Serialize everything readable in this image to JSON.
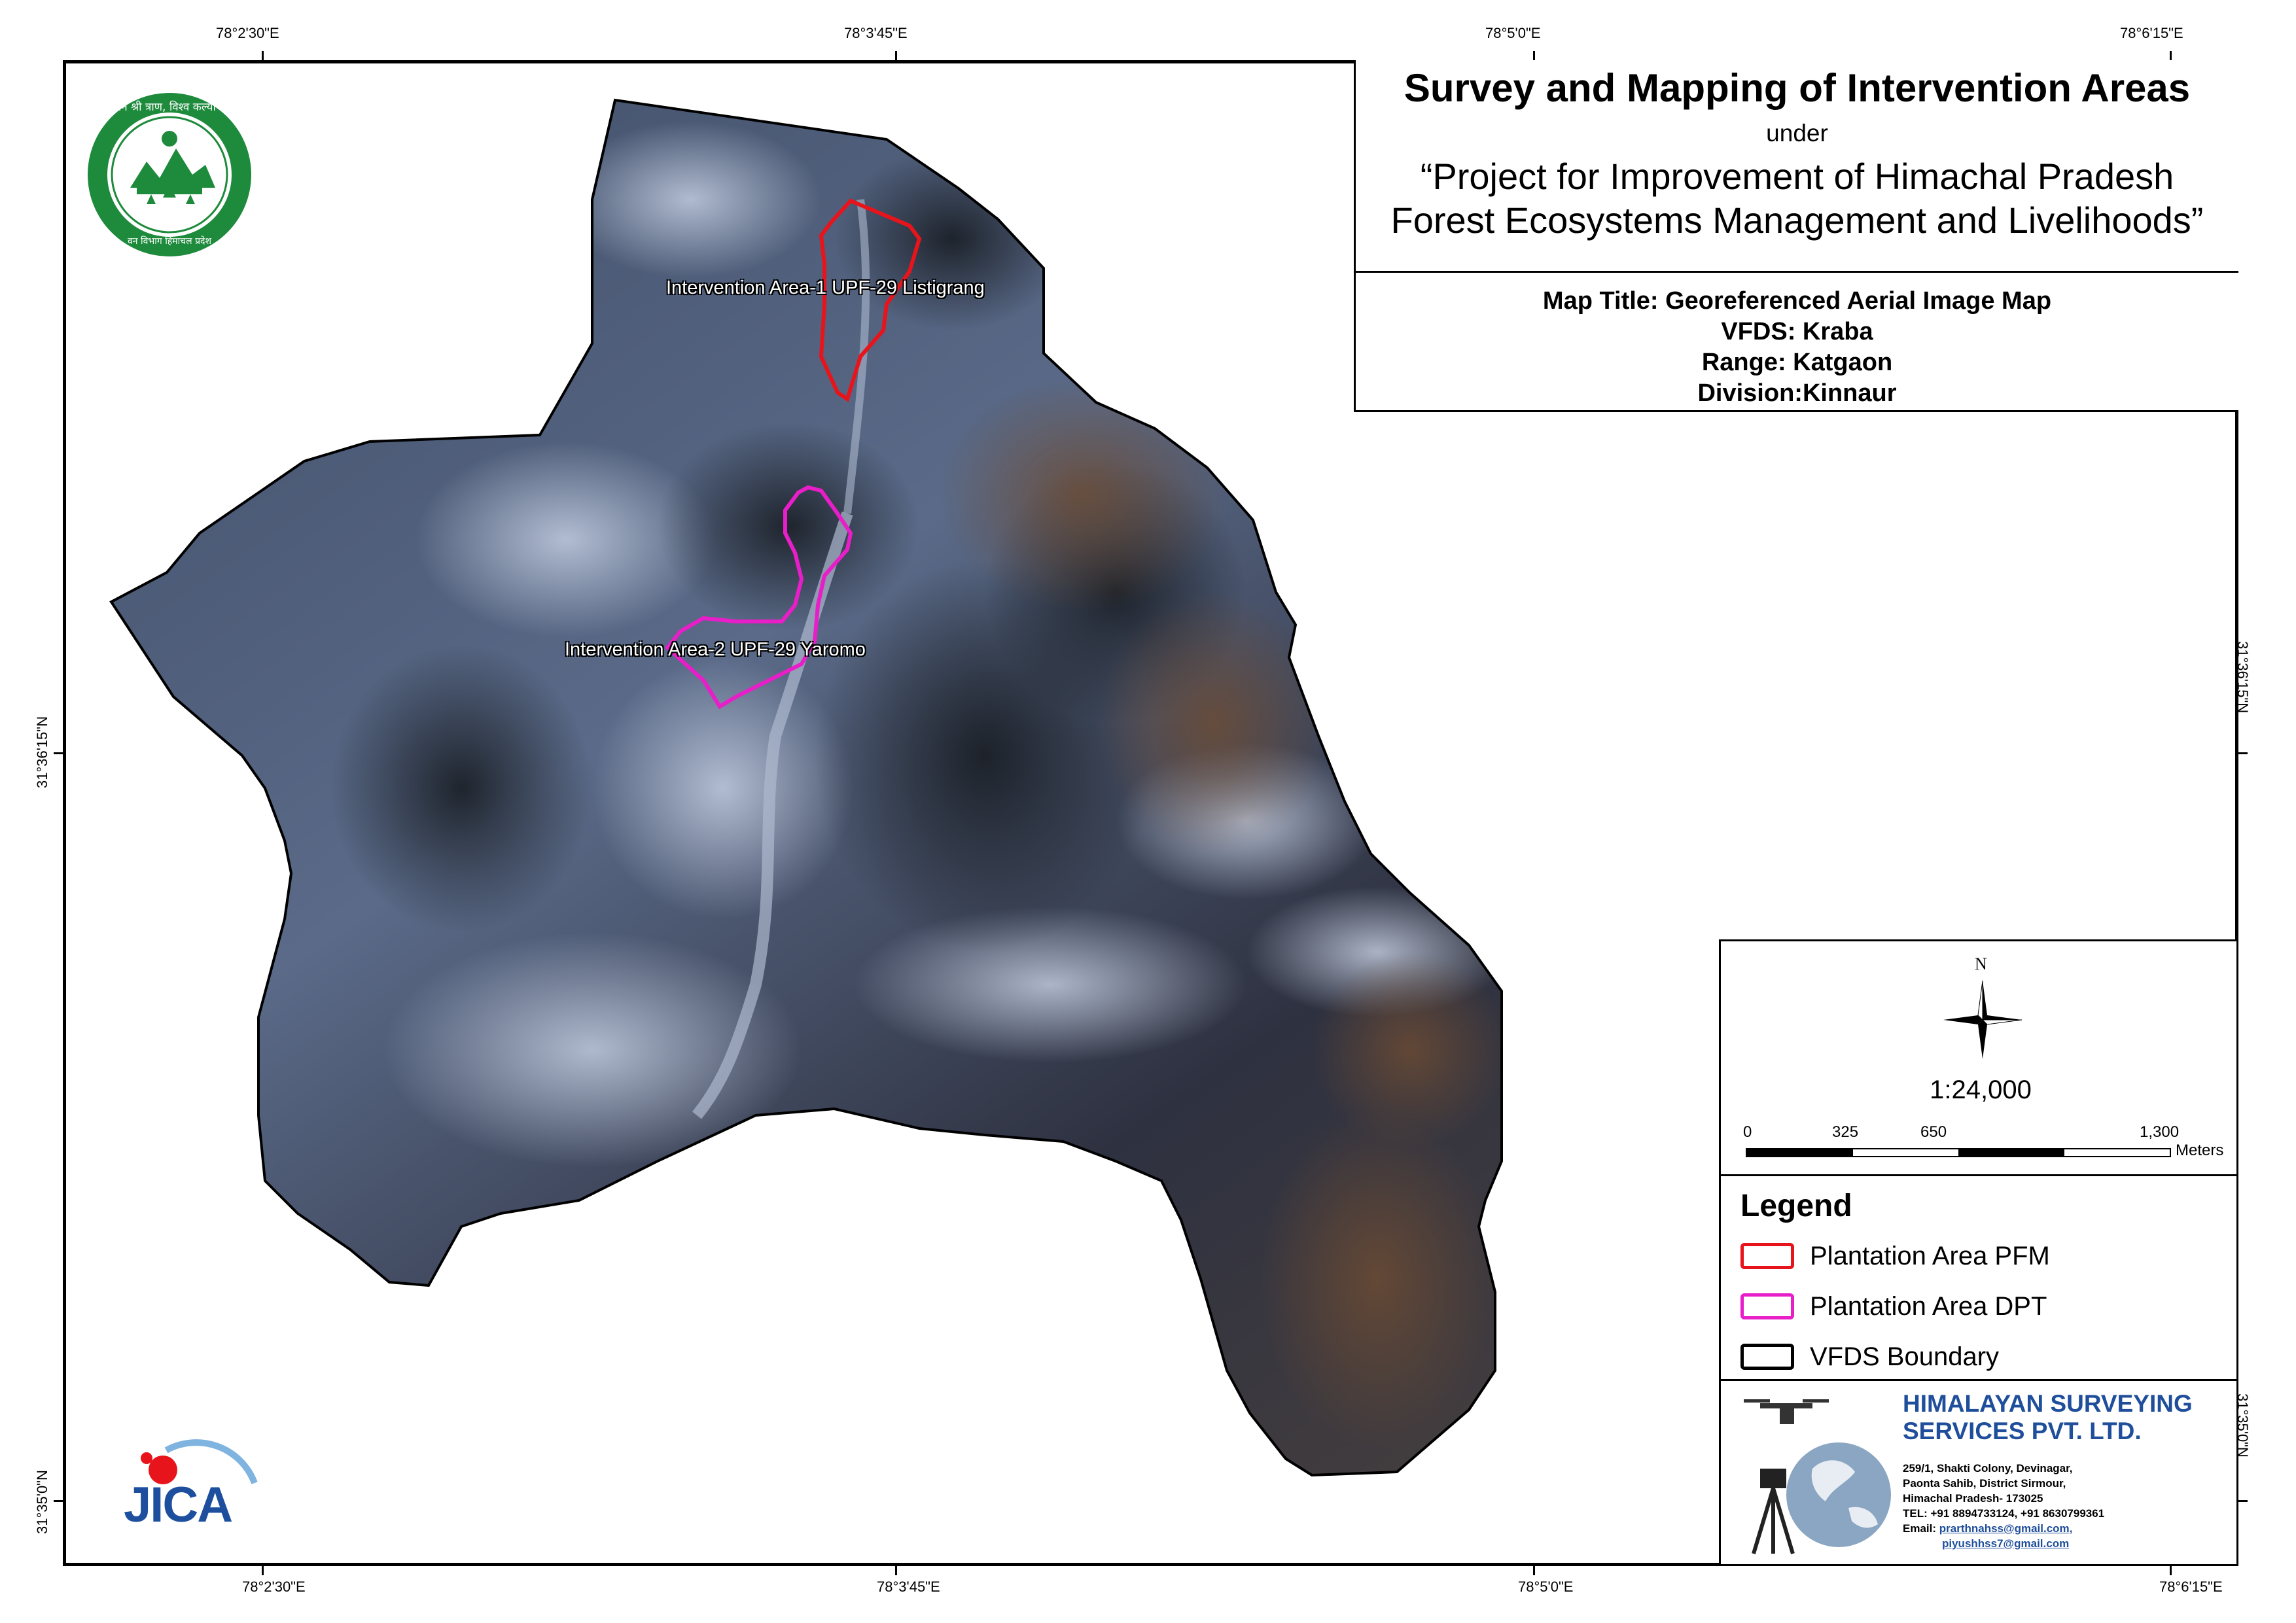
{
  "coordinates": {
    "top_labels": [
      "78°2'30\"E",
      "78°3'45\"E",
      "78°5'0\"E",
      "78°6'15\"E"
    ],
    "bottom_labels": [
      "78°2'30\"E",
      "78°3'45\"E",
      "78°5'0\"E",
      "78°6'15\"E"
    ],
    "left_labels": [
      "31°36'15\"N",
      "31°35'0\"N"
    ],
    "right_labels": [
      "31°36'15\"N",
      "31°35'0\"N"
    ]
  },
  "title_block": {
    "main_title": "Survey and Mapping of Intervention Areas",
    "under": "under",
    "project_line1": "“Project for Improvement of Himachal Pradesh",
    "project_line2": "Forest Ecosystems Management and Livelihoods”"
  },
  "info_block": {
    "map_title": "Map Title: Georeferenced Aerial Image Map",
    "vfds": "VFDS: Kraba",
    "range": "Range: Katgaon",
    "division": "Division:Kinnaur"
  },
  "map_labels": {
    "area1": "Intervention Area-1 UPF-29 Listigrang",
    "area2": "Intervention Area-2 UPF-29 Yaromo"
  },
  "north_arrow": {
    "label": "N"
  },
  "scale": {
    "ratio": "1:24,000",
    "ticks": [
      "0",
      "325",
      "650",
      "1,300"
    ],
    "unit": "Meters"
  },
  "legend": {
    "heading": "Legend",
    "items": [
      {
        "label": "Plantation Area PFM",
        "color": "#e8141b"
      },
      {
        "label": "Plantation Area DPT",
        "color": "#e81ec8"
      },
      {
        "label": "VFDS Boundary",
        "color": "#000000"
      }
    ]
  },
  "company": {
    "name_line1": "HIMALAYAN SURVEYING",
    "name_line2": "SERVICES PVT. LTD.",
    "address1": "259/1, Shakti Colony, Devinagar,",
    "address2": "Paonta Sahib, District Sirmour,",
    "address3": "Himachal Pradesh- 173025",
    "tel": "TEL: +91 8894733124, +91 8630799361",
    "email_label": "Email:",
    "email1": "prarthnahss@gmail.com,",
    "email2": "piyushhss7@gmail.com",
    "name_color": "#1f4e9b"
  },
  "logos": {
    "forest_dept_text_top": "वन श्री त्राण, विश्व कल्याण",
    "forest_dept_text_bottom": "वन विभाग हिमाचल प्रदेश",
    "jica": "JICA"
  }
}
